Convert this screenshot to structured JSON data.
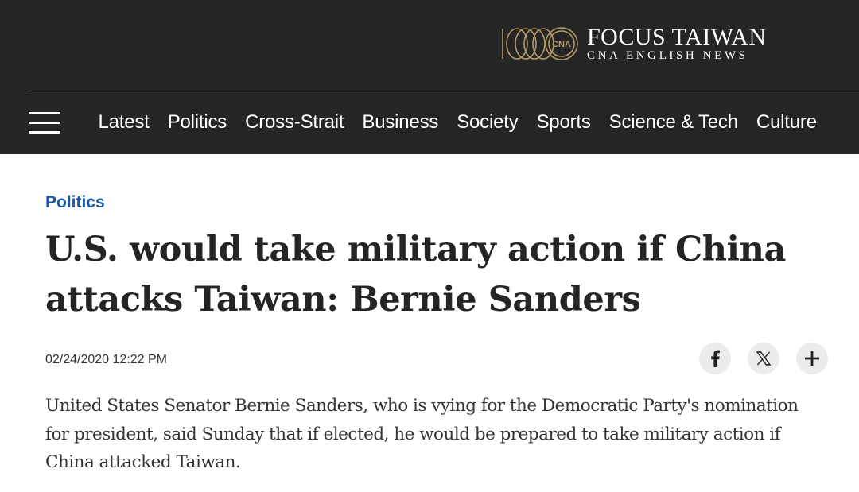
{
  "brand": {
    "title": "FOCUS TAIWAN",
    "subtitle": "CNA ENGLISH NEWS",
    "accent_color": "#b49a6a"
  },
  "nav": {
    "menu_icon": "hamburger-menu-icon",
    "items": [
      {
        "label": "Latest"
      },
      {
        "label": "Politics"
      },
      {
        "label": "Cross-Strait"
      },
      {
        "label": "Business"
      },
      {
        "label": "Society"
      },
      {
        "label": "Sports"
      },
      {
        "label": "Science & Tech"
      },
      {
        "label": "Culture"
      }
    ]
  },
  "article": {
    "category": "Politics",
    "category_color": "#1a58a8",
    "headline": "U.S. would take military action if China attacks Taiwan: Bernie Sanders",
    "timestamp": "02/24/2020 12:22 PM",
    "lede": "United States Senator Bernie Sanders, who is vying for the Democratic Party's nomination for president, said Sunday that if elected, he would be prepared to take military action if China attacked Taiwan."
  },
  "share": {
    "buttons": [
      {
        "icon": "facebook-icon"
      },
      {
        "icon": "x-icon"
      },
      {
        "icon": "plus-icon"
      }
    ]
  }
}
